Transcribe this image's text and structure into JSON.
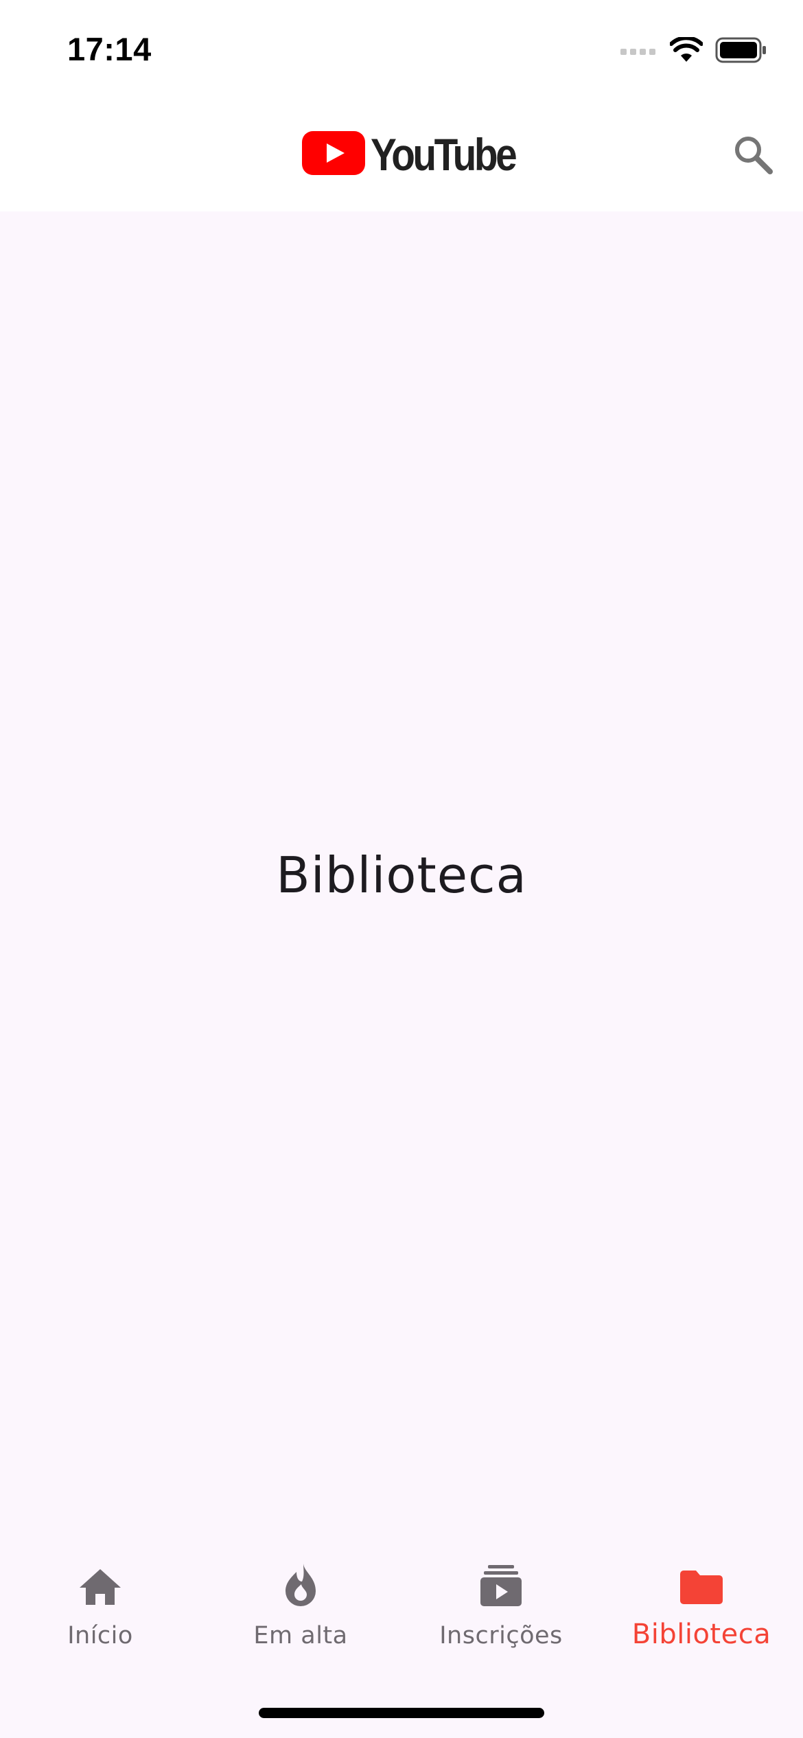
{
  "status_bar": {
    "time": "17:14",
    "icons": [
      "cellular-signal-icon",
      "wifi-icon",
      "battery-icon"
    ]
  },
  "app_bar": {
    "logo_text": "YouTube",
    "logo_icon": "youtube-play-icon",
    "brand_color": "#ff0000",
    "search_icon": "search-icon"
  },
  "main": {
    "heading": "Biblioteca"
  },
  "bottom_nav": {
    "active_color": "#f44336",
    "inactive_color": "#6f6a70",
    "items": [
      {
        "label": "Início",
        "icon": "home-icon",
        "active": false
      },
      {
        "label": "Em alta",
        "icon": "flame-icon",
        "active": false
      },
      {
        "label": "Inscrições",
        "icon": "subscriptions-icon",
        "active": false
      },
      {
        "label": "Biblioteca",
        "icon": "folder-icon",
        "active": true
      }
    ]
  }
}
